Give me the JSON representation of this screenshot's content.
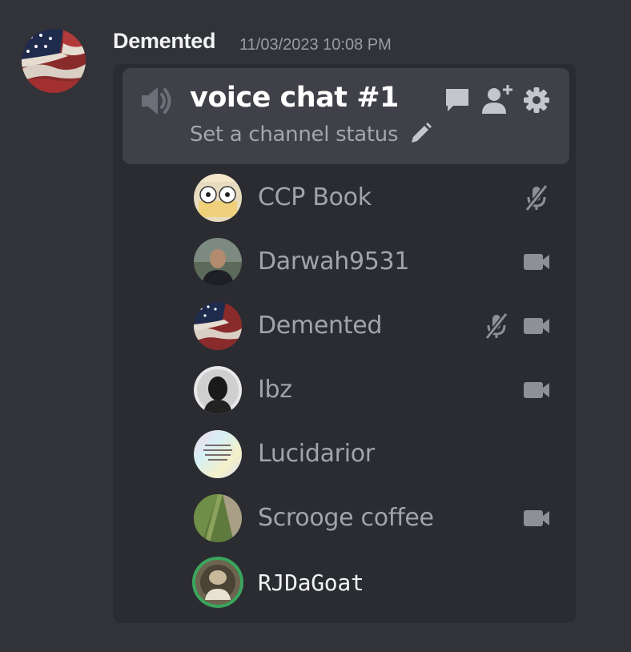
{
  "message": {
    "author": "Demented",
    "timestamp": "11/03/2023 10:08 PM",
    "avatar": "american-flag-avatar"
  },
  "voice_channel": {
    "name": "voice chat #1",
    "status_placeholder": "Set a channel status",
    "icons": [
      "speaker-icon",
      "pencil-icon",
      "chat-icon",
      "add-user-icon",
      "gear-icon"
    ],
    "members": [
      {
        "name": "CCP Book",
        "icons": [
          "mic-muted-icon"
        ],
        "speaking": false
      },
      {
        "name": "Darwah9531",
        "icons": [
          "camera-icon"
        ],
        "speaking": false
      },
      {
        "name": "Demented",
        "icons": [
          "mic-muted-icon",
          "camera-icon"
        ],
        "speaking": false
      },
      {
        "name": "Ibz",
        "icons": [
          "camera-icon"
        ],
        "speaking": false
      },
      {
        "name": "Lucidarior",
        "icons": [],
        "speaking": false
      },
      {
        "name": "Scrooge coffee",
        "icons": [
          "camera-icon"
        ],
        "speaking": false
      },
      {
        "name": "RJDaGoat",
        "icons": [],
        "speaking": true
      }
    ]
  },
  "colors": {
    "background": "#323338",
    "card": "#2b2c31",
    "header": "#404148",
    "speaking": "#3ba55d",
    "muted_text": "#a2a4ab"
  }
}
